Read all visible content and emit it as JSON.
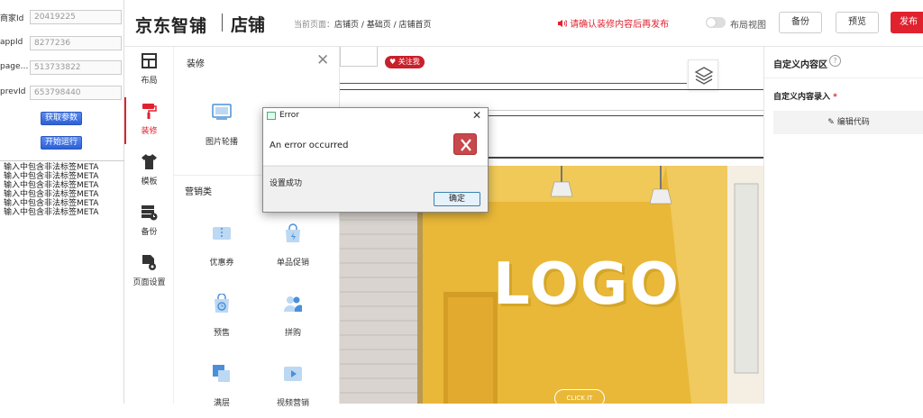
{
  "left_panel": {
    "params": [
      {
        "label": "商家Id",
        "value": "20419225"
      },
      {
        "label": "appId",
        "value": "8277236"
      },
      {
        "label": "pageI...",
        "value": "513733822"
      },
      {
        "label": "prevId",
        "value": "653798440"
      }
    ],
    "get_params_btn": "获取参数",
    "run_btn": "开始运行",
    "log_lines": [
      "输入中包含非法标签META",
      "输入中包含非法标签META",
      "输入中包含非法标签META",
      "输入中包含非法标签META",
      "输入中包含非法标签META",
      "输入中包含非法标签META"
    ]
  },
  "header": {
    "brand": "京东智铺",
    "store": "店铺",
    "crumb_prefix": "当前页面：",
    "crumb_path": "店铺页 / 基础页 / 店铺首页",
    "warning": "请确认装修内容后再发布",
    "layout_view": "布局视图",
    "backup_btn": "备份",
    "preview_btn": "预览",
    "publish_btn": "发布"
  },
  "icon_nav": [
    {
      "label": "布局",
      "icon": "layout-icon",
      "active": false
    },
    {
      "label": "装修",
      "icon": "paint-roller-icon",
      "active": true
    },
    {
      "label": "模板",
      "icon": "shirt-icon",
      "active": false
    },
    {
      "label": "备份",
      "icon": "backup-icon",
      "active": false
    },
    {
      "label": "页面设置",
      "icon": "page-settings-icon",
      "active": false
    }
  ],
  "comp_panel": {
    "title": "装修",
    "decor_items": [
      {
        "label": "图片轮播",
        "icon": "image-carousel-icon"
      }
    ],
    "marketing_title": "营销类",
    "marketing_items": [
      {
        "label": "优惠券",
        "icon": "coupon-icon"
      },
      {
        "label": "单品促销",
        "icon": "promo-bag-icon"
      },
      {
        "label": "预售",
        "icon": "presale-icon"
      },
      {
        "label": "拼购",
        "icon": "group-buy-icon"
      },
      {
        "label": "满层",
        "icon": "tiers-icon"
      },
      {
        "label": "视频营销",
        "icon": "video-icon"
      }
    ]
  },
  "canvas": {
    "follow_badge": "关注我",
    "logo": "LOGO",
    "click_it": "CLICK IT"
  },
  "right_panel": {
    "title": "自定义内容区",
    "content_label": "自定义内容录入",
    "required_mark": "*",
    "edit_code_btn": "编辑代码"
  },
  "dialog": {
    "title": "Error",
    "message": "An error occurred",
    "detail": "设置成功",
    "ok_btn": "确定"
  },
  "colors": {
    "accent": "#e0222e",
    "button_blue": "#2c5fd6",
    "hero_yellow": "#e9b838"
  }
}
